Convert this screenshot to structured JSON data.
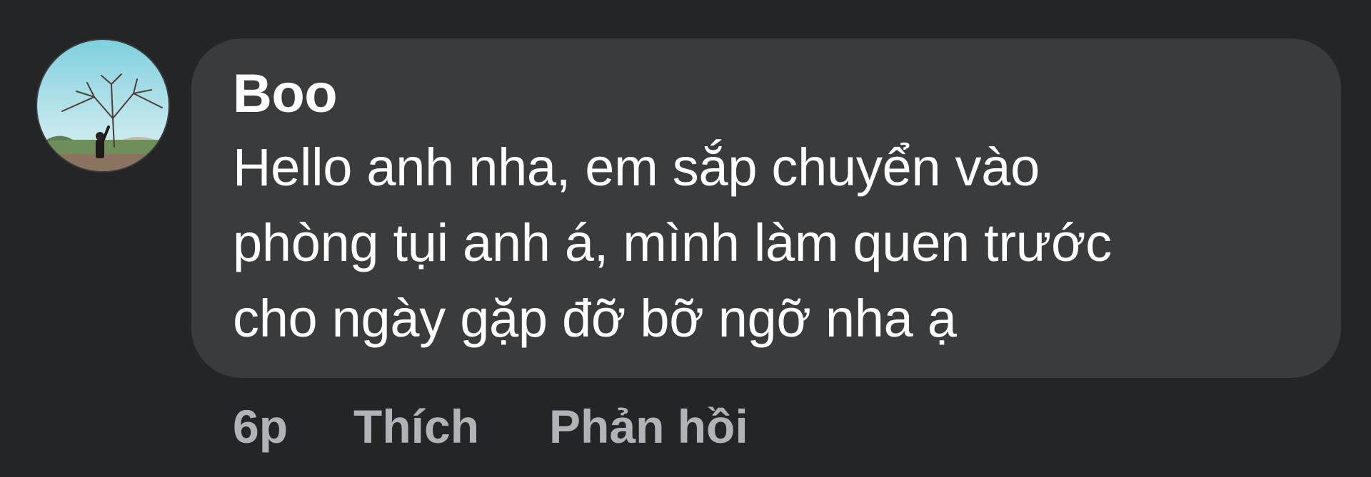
{
  "comment": {
    "author": "Boo",
    "text_lines": [
      "Hello anh nha, em sắp chuyển vào",
      "phòng tụi anh á, mình làm quen trước",
      "cho ngày gặp đỡ bỡ ngỡ nha ạ"
    ],
    "avatar_icon": "user-avatar-photo-tree"
  },
  "actions": {
    "time": "6p",
    "like_label": "Thích",
    "reply_label": "Phản hồi"
  },
  "colors": {
    "background": "#242526",
    "bubble": "#3a3b3c",
    "text": "#ffffff",
    "muted": "#b0b3b8"
  }
}
